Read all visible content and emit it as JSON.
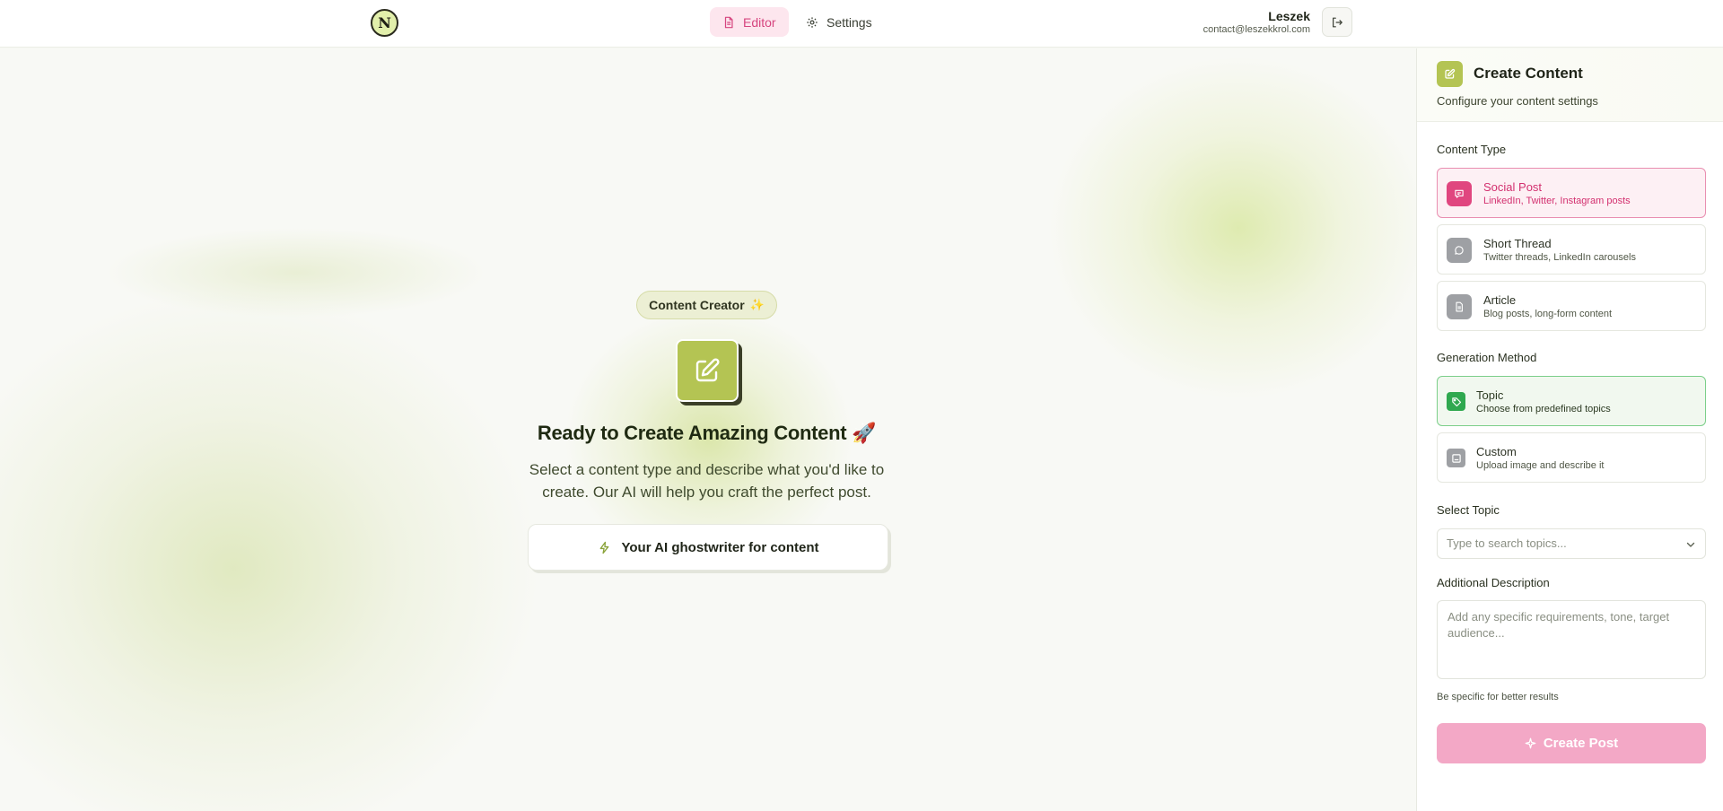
{
  "logo": {
    "text": "N"
  },
  "nav": {
    "tabs": [
      {
        "label": "Editor",
        "icon": "document-icon",
        "active": true
      },
      {
        "label": "Settings",
        "icon": "gear-icon",
        "active": false
      }
    ]
  },
  "user": {
    "name": "Leszek",
    "email": "contact@leszekkrol.com",
    "logout_icon": "logout-icon"
  },
  "hero": {
    "badge": "Content Creator",
    "badge_emoji": "✨",
    "title": "Ready to Create Amazing Content 🚀",
    "description": "Select a content type and describe what you'd like to create. Our AI will help you craft the perfect post.",
    "cta": "Your AI ghostwriter for content",
    "cta_icon": "lightning-icon"
  },
  "panel": {
    "title": "Create Content",
    "subtitle": "Configure your content settings",
    "content_type": {
      "label": "Content Type",
      "options": [
        {
          "title": "Social Post",
          "desc": "LinkedIn, Twitter, Instagram posts",
          "icon": "message-icon",
          "selected": true
        },
        {
          "title": "Short Thread",
          "desc": "Twitter threads, LinkedIn carousels",
          "icon": "chat-bubble-icon",
          "selected": false
        },
        {
          "title": "Article",
          "desc": "Blog posts, long-form content",
          "icon": "document-icon",
          "selected": false
        }
      ]
    },
    "generation_method": {
      "label": "Generation Method",
      "options": [
        {
          "title": "Topic",
          "desc": "Choose from predefined topics",
          "icon": "tag-icon",
          "selected": true
        },
        {
          "title": "Custom",
          "desc": "Upload image and describe it",
          "icon": "image-icon",
          "selected": false
        }
      ]
    },
    "select_topic": {
      "label": "Select Topic",
      "placeholder": "Type to search topics..."
    },
    "additional_description": {
      "label": "Additional Description",
      "placeholder": "Add any specific requirements, tone, target audience...",
      "hint": "Be specific for better results"
    },
    "create_button": "Create Post"
  },
  "colors": {
    "accent_pink": "#e0467f",
    "accent_olive": "#b4c453",
    "accent_green": "#2fa84f"
  }
}
